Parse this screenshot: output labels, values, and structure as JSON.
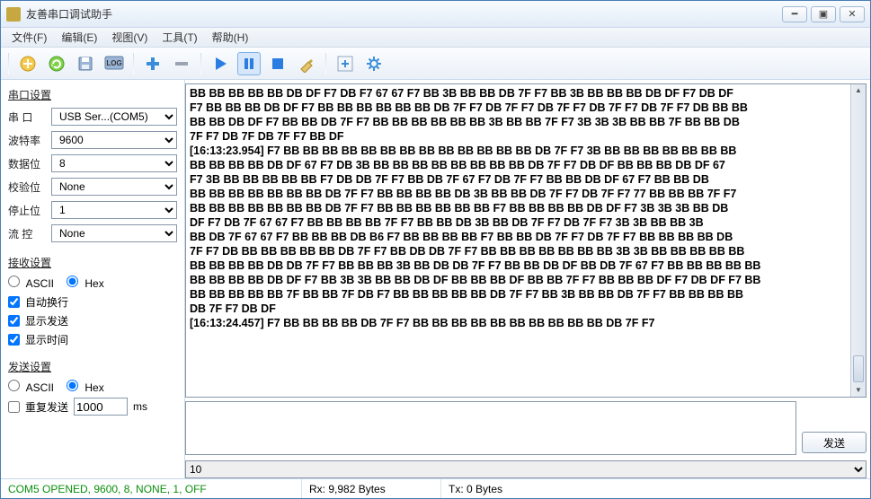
{
  "window": {
    "title": "友善串口调试助手"
  },
  "menu": {
    "file": "文件(F)",
    "edit": "编辑(E)",
    "view": "视图(V)",
    "tools": "工具(T)",
    "help": "帮助(H)"
  },
  "serial": {
    "group": "串口设置",
    "port_label": "串  口",
    "port_value": "USB Ser...(COM5)",
    "baud_label": "波特率",
    "baud_value": "9600",
    "databits_label": "数据位",
    "databits_value": "8",
    "parity_label": "校验位",
    "parity_value": "None",
    "stopbits_label": "停止位",
    "stopbits_value": "1",
    "flow_label": "流  控",
    "flow_value": "None"
  },
  "rx": {
    "group": "接收设置",
    "ascii_label": "ASCII",
    "hex_label": "Hex",
    "hex_selected": true,
    "wrap_label": "自动换行",
    "showsend_label": "显示发送",
    "showtime_label": "显示时间"
  },
  "tx": {
    "group": "发送设置",
    "ascii_label": "ASCII",
    "hex_label": "Hex",
    "hex_selected": true,
    "repeat_label": "重复发送",
    "period_value": "1000",
    "period_unit": "ms",
    "send_label": "发送",
    "cycle_value": "10"
  },
  "data_lines": [
    "BB BB BB BB BB DB DF F7 DB F7 67 67 F7 BB 3B BB BB DB 7F F7 BB 3B BB BB BB DB DF F7 DB DF",
    "F7 BB BB BB DB DF F7 BB BB BB BB BB BB DB 7F F7 DB 7F F7 DB 7F F7 DB 7F F7 DB 7F F7 DB BB BB",
    "BB BB DB DF F7 BB BB DB 7F F7 BB BB BB BB BB BB 3B BB BB 7F F7 3B 3B 3B BB BB 7F BB BB DB",
    "7F F7 DB 7F DB 7F F7 BB DF",
    "[16:13:23.954] F7 BB BB BB BB BB BB BB BB BB BB BB BB BB DB 7F F7 3B BB BB BB BB BB BB BB",
    "BB BB BB BB DB DF 67 F7 DB 3B BB BB BB BB BB BB BB BB DB 7F F7 DB DF BB BB BB DB DF 67",
    "F7 3B BB BB BB BB BB F7 DB DB 7F F7 BB DB 7F 67 F7 DB 7F F7 BB BB DB DF 67 F7 BB BB DB",
    "BB BB BB BB BB BB BB DB 7F F7 BB BB BB BB DB 3B BB BB DB 7F F7 DB 7F F7 77 BB BB BB 7F F7",
    "BB BB BB BB BB BB BB DB 7F F7 BB BB BB BB BB BB F7 BB BB BB BB DB DF F7 3B 3B 3B BB DB",
    "DF F7 DB 7F 67 67 F7 BB BB BB BB 7F F7 BB BB DB 3B BB DB 7F F7 DB 7F F7 3B 3B BB BB 3B",
    "BB DB 7F 67 67 F7 BB BB BB DB B6 F7 BB BB BB BB F7 BB BB DB 7F F7 DB 7F F7 BB BB BB BB DB",
    "7F F7 DB BB BB BB BB BB DB 7F F7 BB DB DB 7F F7 BB BB BB BB BB BB BB 3B 3B BB BB BB BB BB",
    "BB BB BB BB DB DB 7F F7 BB BB BB 3B BB DB DB 7F F7 BB BB DB DF BB DB 7F 67 F7 BB BB BB BB BB",
    "BB BB BB BB DB DF F7 BB 3B 3B BB BB DB DF BB BB BB DF BB BB 7F F7 BB BB BB DF F7 DB DF F7 BB",
    "BB BB BB BB BB 7F BB BB 7F DB F7 BB BB BB BB BB DB 7F F7 BB 3B BB BB DB 7F F7 BB BB BB BB",
    "DB 7F F7 DB DF",
    "[16:13:24.457] F7 BB BB BB BB DB 7F F7 BB BB BB BB BB BB BB BB BB BB DB 7F F7"
  ],
  "status": {
    "conn": "COM5 OPENED, 9600, 8, NONE, 1, OFF",
    "rx": "Rx: 9,982 Bytes",
    "tx": "Tx: 0 Bytes"
  }
}
